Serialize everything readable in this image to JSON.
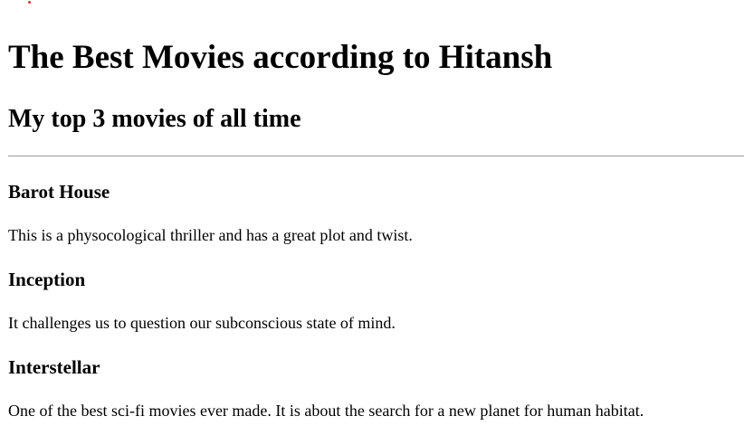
{
  "heading": "The Best Movies according to Hitansh",
  "subheading": "My top 3 movies of all time",
  "movies": [
    {
      "title": "Barot House",
      "description": "This is a physocological thriller and has a great plot and twist."
    },
    {
      "title": "Inception",
      "description": "It challenges us to question our subconscious state of mind."
    },
    {
      "title": "Interstellar",
      "description": "One of the best sci-fi movies ever made. It is about the search for a new planet for human habitat."
    }
  ],
  "colors": {
    "text": "#000000",
    "background": "#ffffff",
    "divider": "#9a9a9a",
    "dot": "#e03030"
  }
}
